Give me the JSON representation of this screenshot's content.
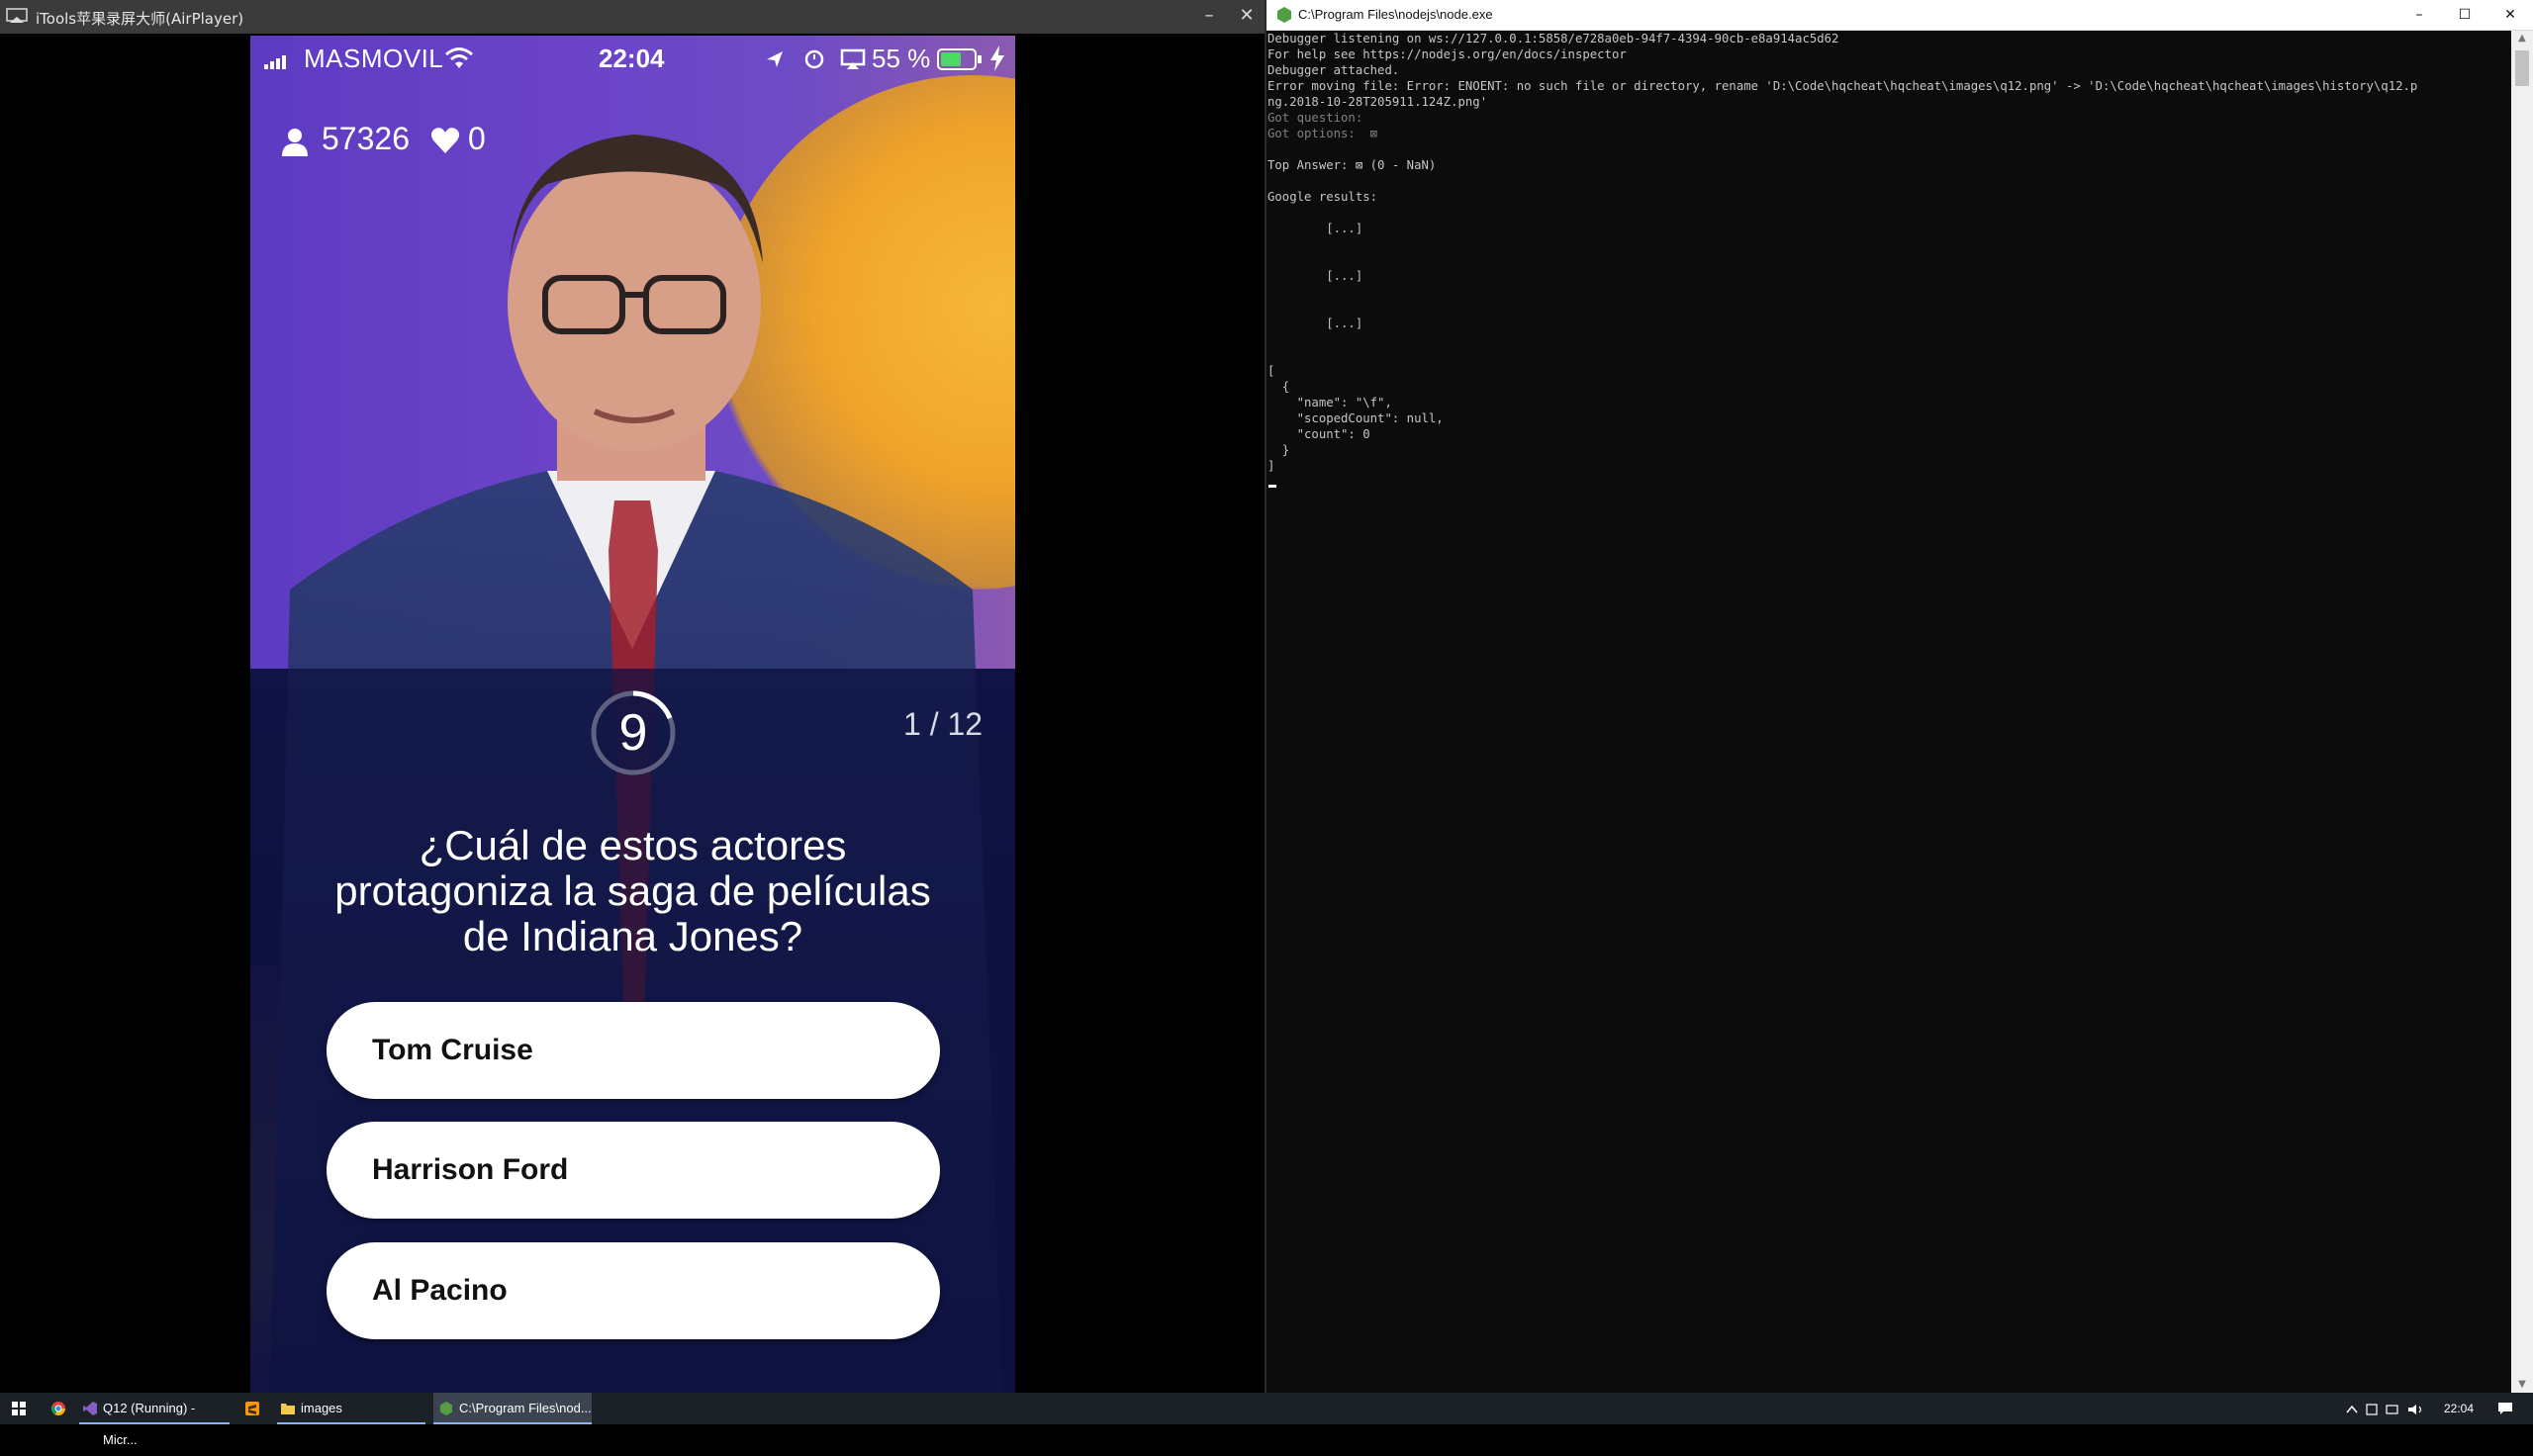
{
  "left_window": {
    "title": "iTools苹果录屏大师(AirPlayer)",
    "buttons": {
      "minimize": "–",
      "close": "✕"
    }
  },
  "phone": {
    "status_bar": {
      "carrier": "MASMOVIL",
      "time": "22:04",
      "battery_percent": "55 %"
    },
    "hud": {
      "viewers": "57326",
      "lives": "0"
    },
    "timer_value": "9",
    "question_counter": "1 / 12",
    "question": "¿Cuál de estos actores protagoniza la saga de películas de Indiana Jones?",
    "answers": [
      {
        "label": "Tom Cruise"
      },
      {
        "label": "Harrison Ford"
      },
      {
        "label": "Al Pacino"
      }
    ]
  },
  "console": {
    "title": "C:\\Program Files\\nodejs\\node.exe",
    "buttons": {
      "minimize": "–",
      "maximize": "☐",
      "close": "✕"
    },
    "lines": [
      "Debugger listening on ws://127.0.0.1:5858/e728a0eb-94f7-4394-90cb-e8a914ac5d62",
      "For help see https://nodejs.org/en/docs/inspector",
      "Debugger attached.",
      "Error moving file: Error: ENOENT: no such file or directory, rename 'D:\\Code\\hqcheat\\hqcheat\\images\\q12.png' -> 'D:\\Code\\hqcheat\\hqcheat\\images\\history\\q12.p",
      "ng.2018-10-28T205911.124Z.png'",
      "Got question:",
      "Got options:  ⊠",
      "",
      "Top Answer: ⊠ (0 - NaN)",
      "",
      "Google results:",
      "",
      "        [...]",
      "",
      "",
      "        [...]",
      "",
      "",
      "        [...]",
      "",
      "",
      "[",
      "  {",
      "    \"name\": \"\\f\",",
      "    \"scopedCount\": null,",
      "    \"count\": 0",
      "  }",
      "]"
    ]
  },
  "taskbar": {
    "items": [
      {
        "label": "Q12 (Running) - Micr..."
      },
      {
        "label": "images"
      },
      {
        "label": "C:\\Program Files\\nod..."
      }
    ],
    "clock": "22:04"
  }
}
